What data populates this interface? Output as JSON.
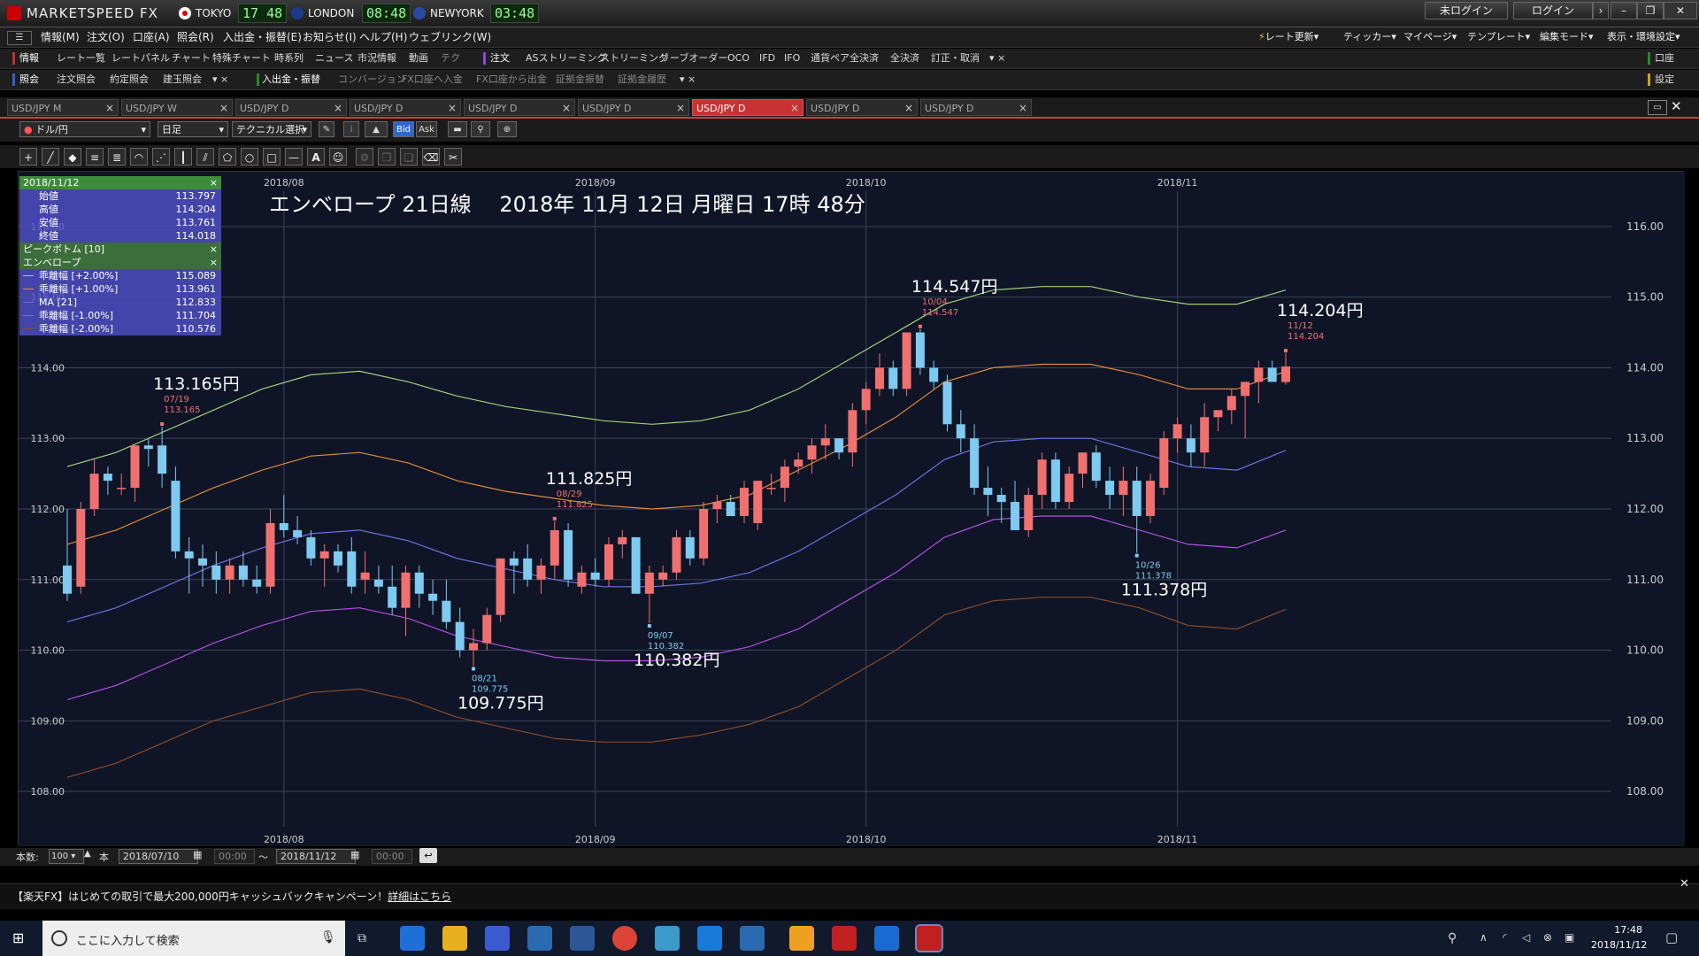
{
  "app": {
    "title": "MARKETSPEED FX",
    "clocks": [
      {
        "label": "TOKYO",
        "time": "17 48",
        "flag_color": "#d00"
      },
      {
        "label": "LONDON",
        "time": "08:48",
        "flag_color": "#1a3a8a"
      },
      {
        "label": "NEWYORK",
        "time": "03:48",
        "flag_color": "#2a4aa0"
      }
    ],
    "login_status": "未ログイン",
    "login_button": "ログイン"
  },
  "menu": {
    "items": [
      "情報(M)",
      "注文(O)",
      "口座(A)",
      "照会(R)",
      "入出金・振替(E)",
      "お知らせ(I)",
      "ヘルプ(H)",
      "ウェブリンク(W)"
    ],
    "right_items": [
      "レート更新",
      "ティッカー",
      "マイページ",
      "テンプレート",
      "編集モード",
      "表示・環境設定"
    ]
  },
  "toolbar_info": {
    "label": "情報",
    "items": [
      "レート一覧",
      "レートパネル",
      "チャート",
      "特殊チャート",
      "時系列",
      "ニュース",
      "市況情報",
      "動画",
      "テク"
    ]
  },
  "toolbar_order": {
    "label": "注文",
    "items": [
      "ASストリーミング",
      "ストリーミング",
      "リーブオーダー",
      "OCO",
      "IFD",
      "IFO",
      "通貨ペア全決済",
      "全決済",
      "訂正・取消"
    ]
  },
  "toolbar_account_right": "口座",
  "toolbar_settings_right": "設定",
  "toolbar_inquiry": {
    "label": "照会",
    "items": [
      "注文照会",
      "約定照会",
      "建玉照会"
    ]
  },
  "toolbar_deposit": {
    "label": "入出金・振替",
    "items": [
      "コンバージョン",
      "FX口座へ入金",
      "FX口座から出金",
      "証拠金振替",
      "証拠金履歴"
    ]
  },
  "tabs": [
    {
      "label": "USD/JPY M",
      "active": false
    },
    {
      "label": "USD/JPY W",
      "active": false
    },
    {
      "label": "USD/JPY D",
      "active": false
    },
    {
      "label": "USD/JPY D",
      "active": false
    },
    {
      "label": "USD/JPY D",
      "active": false
    },
    {
      "label": "USD/JPY D",
      "active": false
    },
    {
      "label": "USD/JPY D",
      "active": true
    },
    {
      "label": "USD/JPY D",
      "active": false
    },
    {
      "label": "USD/JPY D",
      "active": false
    }
  ],
  "chart_toolbar": {
    "pair": "ドル/円",
    "timeframe": "日足",
    "technical": "テクニカル選択",
    "bid": "Bid",
    "ask": "Ask"
  },
  "info_panel": {
    "date": "2018/11/12",
    "ohlc": [
      {
        "label": "始値",
        "value": "113.797"
      },
      {
        "label": "高値",
        "value": "114.204"
      },
      {
        "label": "安値",
        "value": "113.761"
      },
      {
        "label": "終値",
        "value": "114.018"
      }
    ],
    "peak_bottom": "ピークボトム [10]",
    "envelope": "エンベロープ",
    "envelope_rows": [
      {
        "label": "乖離幅 [+2.00%]",
        "value": "115.089",
        "color": "#9fd07a"
      },
      {
        "label": "乖離幅 [+1.00%]",
        "value": "113.961",
        "color": "#e08a3a"
      },
      {
        "label": "MA [21]",
        "value": "112.833",
        "color": "#6f6fe0"
      },
      {
        "label": "乖離幅 [-1.00%]",
        "value": "111.704",
        "color": "#b050e0"
      },
      {
        "label": "乖離幅 [-2.00%]",
        "value": "110.576",
        "color": "#8a4a2a"
      }
    ]
  },
  "bottom": {
    "count_label": "本数:",
    "count_value": "100",
    "unit": "本",
    "date_from": "2018/07/10",
    "time_from": "00:00",
    "tilde": "～",
    "date_to": "2018/11/12",
    "time_to": "00:00"
  },
  "status_text": "【楽天FX】はじめての取引で最大200,000円キャッシュバックキャンペーン！",
  "status_link": "詳細はこちら",
  "taskbar": {
    "search_placeholder": "ここに入力して検索",
    "time": "17:48",
    "date": "2018/11/12"
  },
  "chart_data": {
    "type": "candlestick",
    "title": "エンベロープ 21日線　 2018年 11月 12日 月曜日 17時 48分",
    "ylim": [
      107.5,
      116.5
    ],
    "y_ticks": [
      "116.00",
      "115.00",
      "114.00",
      "113.00",
      "112.00",
      "111.00",
      "110.00",
      "109.00",
      "108.00"
    ],
    "x_ticks": [
      {
        "label": "2018/08",
        "index": 16
      },
      {
        "label": "2018/09",
        "index": 39
      },
      {
        "label": "2018/10",
        "index": 59
      },
      {
        "label": "2018/11",
        "index": 82
      }
    ],
    "candles": [
      [
        111.2,
        112.0,
        110.7,
        110.8
      ],
      [
        110.9,
        112.1,
        110.8,
        112.0
      ],
      [
        112.0,
        112.7,
        111.9,
        112.5
      ],
      [
        112.5,
        112.6,
        112.2,
        112.4
      ],
      [
        112.3,
        112.5,
        112.2,
        112.3
      ],
      [
        112.3,
        112.9,
        112.1,
        112.9
      ],
      [
        112.9,
        113.0,
        112.6,
        112.85
      ],
      [
        112.9,
        113.165,
        112.3,
        112.5
      ],
      [
        112.4,
        112.6,
        111.3,
        111.4
      ],
      [
        111.4,
        111.6,
        110.8,
        111.3
      ],
      [
        111.3,
        111.5,
        110.9,
        111.2
      ],
      [
        111.2,
        111.4,
        110.8,
        111.0
      ],
      [
        111.0,
        111.3,
        110.8,
        111.2
      ],
      [
        111.2,
        111.4,
        110.9,
        111.0
      ],
      [
        111.0,
        111.2,
        110.8,
        110.9
      ],
      [
        110.9,
        112.0,
        110.8,
        111.8
      ],
      [
        111.8,
        112.2,
        111.6,
        111.7
      ],
      [
        111.7,
        111.9,
        111.5,
        111.6
      ],
      [
        111.6,
        111.7,
        111.2,
        111.3
      ],
      [
        111.3,
        111.5,
        110.9,
        111.4
      ],
      [
        111.4,
        111.5,
        111.1,
        111.2
      ],
      [
        111.4,
        111.6,
        110.8,
        110.9
      ],
      [
        111.0,
        111.4,
        110.8,
        111.1
      ],
      [
        111.0,
        111.2,
        110.8,
        110.9
      ],
      [
        110.9,
        111.2,
        110.5,
        110.6
      ],
      [
        110.6,
        111.2,
        110.2,
        111.1
      ],
      [
        111.1,
        111.2,
        110.6,
        110.8
      ],
      [
        110.8,
        111.0,
        110.5,
        110.7
      ],
      [
        110.7,
        111.0,
        110.3,
        110.4
      ],
      [
        110.4,
        110.6,
        109.9,
        110.0
      ],
      [
        110.0,
        110.3,
        109.775,
        110.1
      ],
      [
        110.1,
        110.6,
        110.0,
        110.5
      ],
      [
        110.5,
        111.3,
        110.4,
        111.3
      ],
      [
        111.3,
        111.4,
        110.8,
        111.2
      ],
      [
        111.3,
        111.5,
        110.9,
        111.0
      ],
      [
        111.0,
        111.3,
        110.8,
        111.2
      ],
      [
        111.2,
        111.825,
        111.0,
        111.7
      ],
      [
        111.7,
        111.8,
        110.9,
        111.0
      ],
      [
        110.9,
        111.2,
        110.8,
        111.1
      ],
      [
        111.1,
        111.3,
        110.9,
        111.0
      ],
      [
        111.0,
        111.6,
        110.9,
        111.5
      ],
      [
        111.5,
        111.7,
        111.3,
        111.6
      ],
      [
        111.6,
        111.6,
        110.8,
        110.8
      ],
      [
        110.8,
        111.2,
        110.382,
        111.1
      ],
      [
        111.0,
        111.2,
        110.9,
        111.1
      ],
      [
        111.1,
        111.7,
        111.0,
        111.6
      ],
      [
        111.6,
        111.7,
        111.2,
        111.3
      ],
      [
        111.3,
        112.1,
        111.2,
        112.0
      ],
      [
        112.0,
        112.2,
        111.8,
        112.1
      ],
      [
        112.1,
        112.2,
        111.9,
        111.9
      ],
      [
        111.9,
        112.4,
        111.8,
        112.3
      ],
      [
        111.8,
        112.4,
        111.7,
        112.4
      ],
      [
        112.3,
        112.5,
        112.2,
        112.3
      ],
      [
        112.3,
        112.7,
        112.1,
        112.6
      ],
      [
        112.6,
        112.8,
        112.5,
        112.7
      ],
      [
        112.7,
        113.0,
        112.5,
        112.9
      ],
      [
        112.9,
        113.2,
        112.7,
        113.0
      ],
      [
        113.0,
        113.0,
        112.7,
        112.8
      ],
      [
        112.8,
        113.5,
        112.6,
        113.4
      ],
      [
        113.4,
        113.8,
        113.2,
        113.7
      ],
      [
        113.7,
        114.2,
        113.6,
        114.0
      ],
      [
        114.0,
        114.1,
        113.6,
        113.7
      ],
      [
        113.7,
        114.5,
        113.6,
        114.5
      ],
      [
        114.5,
        114.547,
        113.9,
        114.0
      ],
      [
        114.0,
        114.1,
        113.7,
        113.8
      ],
      [
        113.8,
        113.9,
        113.1,
        113.2
      ],
      [
        113.2,
        113.4,
        112.8,
        113.0
      ],
      [
        113.0,
        113.2,
        112.2,
        112.3
      ],
      [
        112.3,
        112.6,
        111.9,
        112.2
      ],
      [
        112.2,
        112.3,
        111.8,
        112.1
      ],
      [
        112.1,
        112.4,
        111.7,
        111.7
      ],
      [
        111.7,
        112.3,
        111.6,
        112.2
      ],
      [
        112.2,
        112.8,
        112.0,
        112.7
      ],
      [
        112.7,
        112.8,
        112.0,
        112.1
      ],
      [
        112.1,
        112.6,
        112.0,
        112.5
      ],
      [
        112.5,
        112.8,
        112.3,
        112.8
      ],
      [
        112.8,
        112.9,
        112.3,
        112.4
      ],
      [
        112.4,
        112.6,
        112.0,
        112.2
      ],
      [
        112.2,
        112.6,
        111.9,
        112.4
      ],
      [
        112.4,
        112.6,
        111.378,
        111.9
      ],
      [
        111.9,
        112.5,
        111.8,
        112.4
      ],
      [
        112.3,
        113.1,
        112.2,
        113.0
      ],
      [
        113.0,
        113.3,
        112.8,
        113.2
      ],
      [
        113.0,
        113.2,
        112.6,
        112.8
      ],
      [
        112.8,
        113.5,
        112.6,
        113.3
      ],
      [
        113.3,
        113.4,
        113.1,
        113.4
      ],
      [
        113.4,
        113.7,
        113.2,
        113.6
      ],
      [
        113.6,
        113.8,
        113.0,
        113.8
      ],
      [
        113.8,
        114.1,
        113.5,
        114.0
      ],
      [
        114.0,
        114.1,
        113.8,
        113.8
      ],
      [
        113.797,
        114.204,
        113.761,
        114.018
      ]
    ],
    "envelope": [
      {
        "name": "乖離幅 [+2.00%]",
        "color": "#9fd07a",
        "values": [
          112.6,
          112.8,
          113.1,
          113.4,
          113.7,
          113.9,
          113.95,
          113.8,
          113.6,
          113.45,
          113.35,
          113.25,
          113.2,
          113.25,
          113.4,
          113.7,
          114.1,
          114.5,
          114.9,
          115.1,
          115.15,
          115.15,
          115.0,
          114.9,
          114.9,
          115.1
        ]
      },
      {
        "name": "乖離幅 [+1.00%]",
        "color": "#e08a3a",
        "values": [
          111.5,
          111.7,
          112.0,
          112.3,
          112.55,
          112.75,
          112.8,
          112.65,
          112.4,
          112.25,
          112.15,
          112.05,
          112.0,
          112.05,
          112.2,
          112.55,
          112.9,
          113.3,
          113.8,
          114.0,
          114.05,
          114.05,
          113.9,
          113.7,
          113.7,
          113.95
        ]
      },
      {
        "name": "MA [21]",
        "color": "#6f6fe0",
        "values": [
          110.4,
          110.6,
          110.9,
          111.2,
          111.45,
          111.65,
          111.7,
          111.55,
          111.3,
          111.15,
          111.0,
          110.9,
          110.9,
          110.95,
          111.1,
          111.4,
          111.8,
          112.2,
          112.7,
          112.95,
          113.0,
          113.0,
          112.8,
          112.6,
          112.55,
          112.83
        ]
      },
      {
        "name": "乖離幅 [-1.00%]",
        "color": "#b050e0",
        "values": [
          109.3,
          109.5,
          109.8,
          110.1,
          110.35,
          110.55,
          110.6,
          110.45,
          110.2,
          110.05,
          109.9,
          109.85,
          109.85,
          109.9,
          110.05,
          110.3,
          110.7,
          111.1,
          111.6,
          111.85,
          111.9,
          111.9,
          111.7,
          111.5,
          111.45,
          111.7
        ]
      },
      {
        "name": "乖離幅 [-2.00%]",
        "color": "#8a4a2a",
        "values": [
          108.2,
          108.4,
          108.7,
          109.0,
          109.2,
          109.4,
          109.45,
          109.3,
          109.05,
          108.9,
          108.75,
          108.7,
          108.7,
          108.8,
          108.95,
          109.2,
          109.6,
          110.0,
          110.5,
          110.7,
          110.75,
          110.75,
          110.6,
          110.35,
          110.3,
          110.58
        ]
      }
    ],
    "annotations": [
      {
        "label": "113.165円",
        "date": "07/19",
        "price": "113.165",
        "index": 7,
        "value": 113.165,
        "type": "peak"
      },
      {
        "label": "109.775円",
        "date": "08/21",
        "price": "109.775",
        "index": 30,
        "value": 109.775,
        "type": "bottom"
      },
      {
        "label": "111.825円",
        "date": "08/29",
        "price": "111.825",
        "index": 36,
        "value": 111.825,
        "type": "peak"
      },
      {
        "label": "110.382円",
        "date": "09/07",
        "price": "110.382",
        "index": 43,
        "value": 110.382,
        "type": "bottom"
      },
      {
        "label": "114.547円",
        "date": "10/04",
        "price": "114.547",
        "index": 63,
        "value": 114.547,
        "type": "peak"
      },
      {
        "label": "111.378円",
        "date": "10/26",
        "price": "111.378",
        "index": 79,
        "value": 111.378,
        "type": "bottom"
      },
      {
        "label": "114.204円",
        "date": "11/12",
        "price": "114.204",
        "index": 90,
        "value": 114.204,
        "type": "peak"
      }
    ],
    "colors": {
      "up": "#f07070",
      "down": "#7ecaf0",
      "grid": "#3a4258",
      "background": "#0f1526"
    }
  }
}
